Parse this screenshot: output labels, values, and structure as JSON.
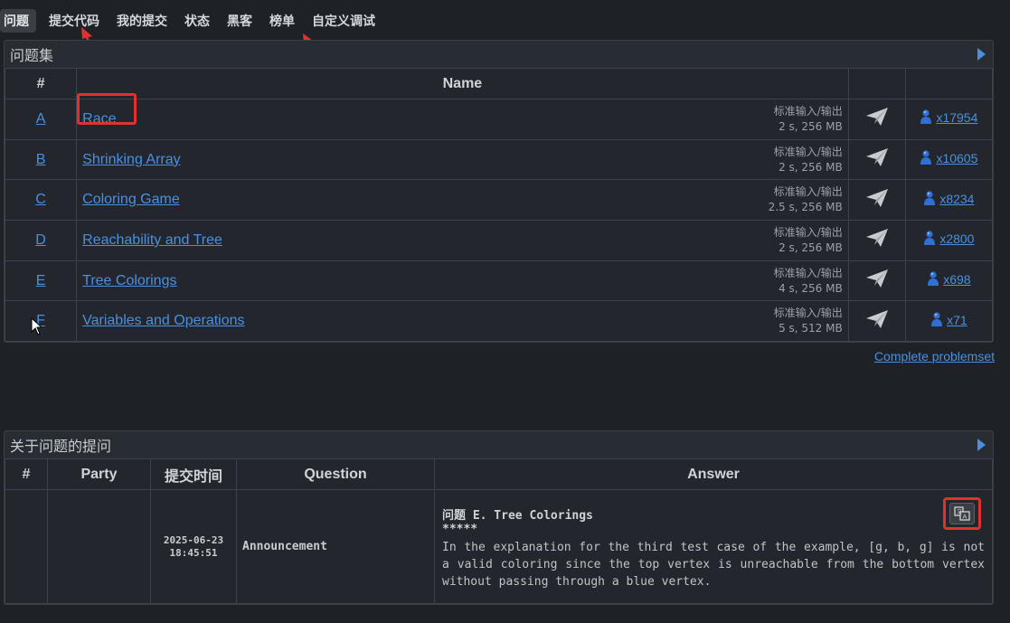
{
  "nav": {
    "items": [
      {
        "label": "问题",
        "active": true
      },
      {
        "label": "提交代码",
        "active": false
      },
      {
        "label": "我的提交",
        "active": false
      },
      {
        "label": "状态",
        "active": false
      },
      {
        "label": "黑客",
        "active": false
      },
      {
        "label": "榜单",
        "active": false
      },
      {
        "label": "自定义调试",
        "active": false
      }
    ]
  },
  "problemset": {
    "title": "问题集",
    "headers": {
      "idx": "#",
      "name": "Name"
    },
    "problems": [
      {
        "idx": "A",
        "name": "Race",
        "io": "标准输入/输出",
        "limits": "2 s, 256 MB",
        "solved": " x17954",
        "highlighted": true
      },
      {
        "idx": "B",
        "name": "Shrinking Array",
        "io": "标准输入/输出",
        "limits": "2 s, 256 MB",
        "solved": " x10605",
        "highlighted": false
      },
      {
        "idx": "C",
        "name": "Coloring Game",
        "io": "标准输入/输出",
        "limits": "2.5 s, 256 MB",
        "solved": " x8234",
        "highlighted": false
      },
      {
        "idx": "D",
        "name": "Reachability and Tree",
        "io": "标准输入/输出",
        "limits": "2 s, 256 MB",
        "solved": " x2800",
        "highlighted": false
      },
      {
        "idx": "E",
        "name": "Tree Colorings",
        "io": "标准输入/输出",
        "limits": "4 s, 256 MB",
        "solved": " x698",
        "highlighted": false
      },
      {
        "idx": "F",
        "name": "Variables and Operations",
        "io": "标准输入/输出",
        "limits": "5 s, 512 MB",
        "solved": " x71",
        "highlighted": false
      }
    ],
    "complete_link": "Complete problemset"
  },
  "questions": {
    "title": "关于问题的提问",
    "headers": {
      "hash": "#",
      "party": "Party",
      "time": "提交时间",
      "question": "Question",
      "answer": "Answer"
    },
    "rows": [
      {
        "hash": "",
        "party": "",
        "date": "2025-06-23",
        "time": "18:45:51",
        "question": "Announcement",
        "answer_title": "问题 E. Tree Colorings",
        "answer_stars": "*****",
        "answer_body": "In the explanation for the third test case of the example, [g, b, g] is not a valid coloring since the top vertex is unreachable from the bottom vertex without passing through a blue vertex."
      }
    ]
  },
  "colors": {
    "background": "#1e2227",
    "panel": "#282c33",
    "link": "#4a8fe0",
    "highlight": "#e03131"
  },
  "icons": {
    "submit": "paper-plane-icon",
    "solved": "user-icon",
    "translate": "translate-icon",
    "panel_toggle": "triangle-right-icon"
  }
}
